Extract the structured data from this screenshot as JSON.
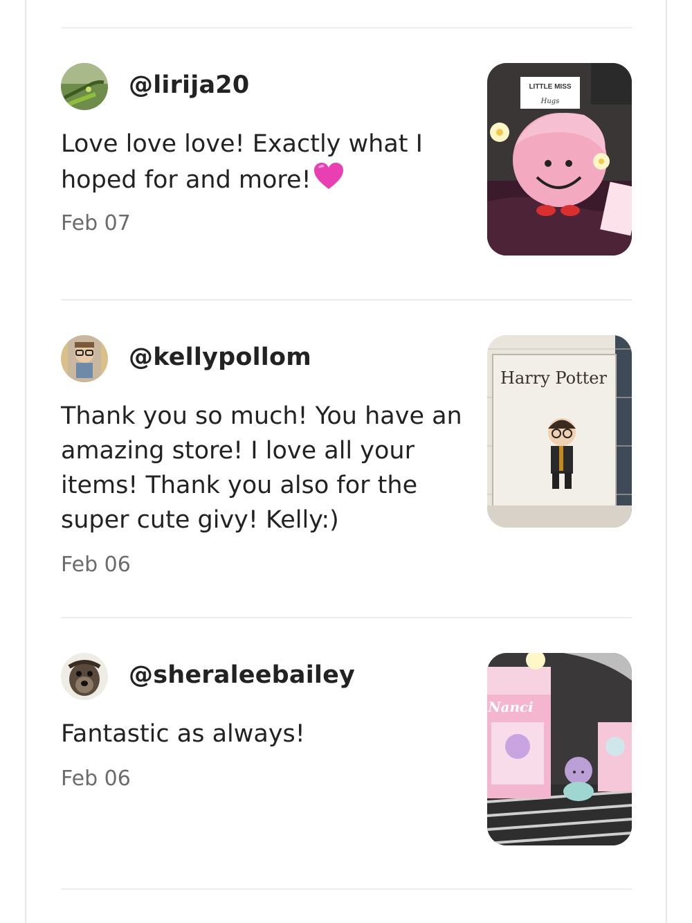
{
  "reviews": [
    {
      "username": "@lirija20",
      "text": "Love love love! Exactly what I hoped for and more!",
      "emoji": "heart-icon",
      "date": "Feb 07",
      "photo_label": "LITTLE MISS",
      "photo_sublabel": "Hugs"
    },
    {
      "username": "@kellypollom",
      "text": "Thank you so much! You have an amazing store! I love all your items! Thank you also for the super cute givy! Kelly:)",
      "date": "Feb 06",
      "photo_label": "Harry Potter"
    },
    {
      "username": "@sheraleebailey",
      "text": "Fantastic as always!",
      "date": "Feb 06",
      "photo_label": "Nanci"
    }
  ],
  "colors": {
    "text": "#222222",
    "date": "#6b6b6b",
    "divider": "#ececec",
    "heart": "#e83fb3"
  }
}
